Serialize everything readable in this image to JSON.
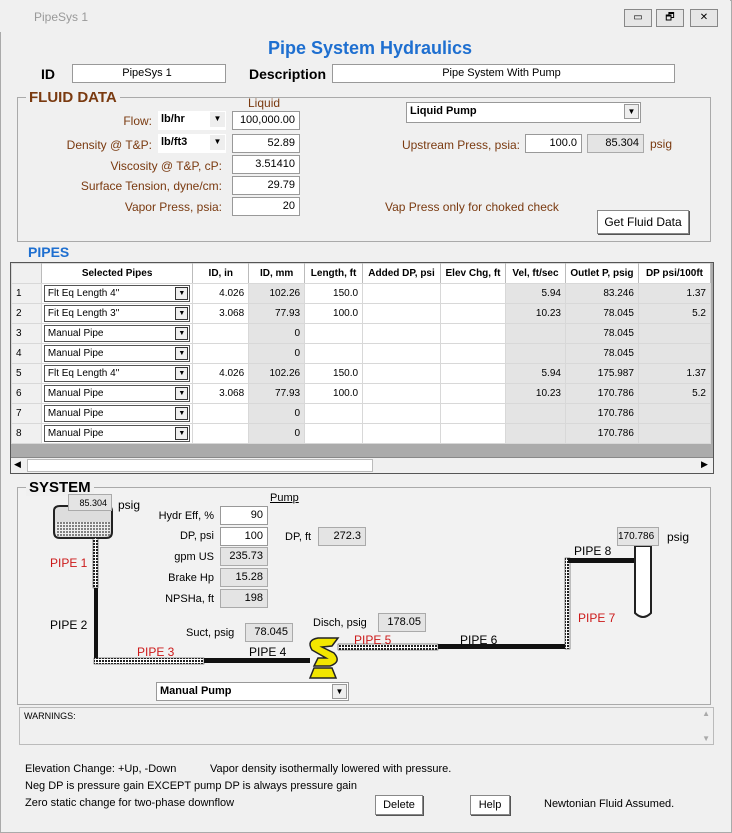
{
  "window": {
    "title": "PipeSys 1",
    "minimize": "▭",
    "restore": "🗗",
    "close": "✕"
  },
  "header": {
    "title": "Pipe System Hydraulics",
    "id_label": "ID",
    "id_value": "PipeSys 1",
    "desc_label": "Description",
    "desc_value": "Pipe System With Pump"
  },
  "fluid": {
    "title": "FLUID DATA",
    "phase": "Liquid",
    "flow_label": "Flow:",
    "flow_unit": "lb/hr",
    "flow": "100,000.00",
    "density_label": "Density @ T&P:",
    "density_unit": "lb/ft3",
    "density": "52.89",
    "visc_label": "Viscosity @ T&P, cP:",
    "visc": "3.51410",
    "st_label": "Surface Tension, dyne/cm:",
    "st": "29.79",
    "vp_label": "Vapor Press, psia:",
    "vp": "20",
    "type": "Liquid Pump",
    "up_label": "Upstream Press, psia:",
    "up_psia": "100.0",
    "up_psig": "85.304",
    "psig": "psig",
    "vp_note": "Vap Press only for choked check",
    "get_btn": "Get Fluid Data"
  },
  "pipes": {
    "title": "PIPES",
    "headers": [
      "Selected Pipes",
      "ID, in",
      "ID, mm",
      "Length, ft",
      "Added DP, psi",
      "Elev Chg, ft",
      "Vel, ft/sec",
      "Outlet P, psig",
      "DP psi/100ft"
    ],
    "rows": [
      {
        "n": "1",
        "pipe": "Flt Eq Length 4\"",
        "idin": "4.026",
        "idmm": "102.26",
        "len": "150.0",
        "adp": "",
        "elev": "",
        "vel": "5.94",
        "out": "83.246",
        "dp": "1.37"
      },
      {
        "n": "2",
        "pipe": "Fit Eq Length 3\"",
        "idin": "3.068",
        "idmm": "77.93",
        "len": "100.0",
        "adp": "",
        "elev": "",
        "vel": "10.23",
        "out": "78.045",
        "dp": "5.2"
      },
      {
        "n": "3",
        "pipe": "Manual Pipe",
        "idin": "",
        "idmm": "0",
        "len": "",
        "adp": "",
        "elev": "",
        "vel": "",
        "out": "78.045",
        "dp": ""
      },
      {
        "n": "4",
        "pipe": "Manual Pipe",
        "idin": "",
        "idmm": "0",
        "len": "",
        "adp": "",
        "elev": "",
        "vel": "",
        "out": "78.045",
        "dp": ""
      },
      {
        "n": "5",
        "pipe": "Flt Eq Length 4\"",
        "idin": "4.026",
        "idmm": "102.26",
        "len": "150.0",
        "adp": "",
        "elev": "",
        "vel": "5.94",
        "out": "175.987",
        "dp": "1.37"
      },
      {
        "n": "6",
        "pipe": "Manual Pipe",
        "idin": "3.068",
        "idmm": "77.93",
        "len": "100.0",
        "adp": "",
        "elev": "",
        "vel": "10.23",
        "out": "170.786",
        "dp": "5.2"
      },
      {
        "n": "7",
        "pipe": "Manual Pipe",
        "idin": "",
        "idmm": "0",
        "len": "",
        "adp": "",
        "elev": "",
        "vel": "",
        "out": "170.786",
        "dp": ""
      },
      {
        "n": "8",
        "pipe": "Manual Pipe",
        "idin": "",
        "idmm": "0",
        "len": "",
        "adp": "",
        "elev": "",
        "vel": "",
        "out": "170.786",
        "dp": ""
      }
    ]
  },
  "system": {
    "title": "SYSTEM",
    "src_psig": "85.304",
    "psig": "psig",
    "pump_title": "Pump",
    "eff_label": "Hydr Eff, %",
    "eff": "90",
    "dp_label": "DP, psi",
    "dp": "100",
    "dpft_label": "DP, ft",
    "dpft": "272.3",
    "gpm_label": "gpm US",
    "gpm": "235.73",
    "bhp_label": "Brake Hp",
    "bhp": "15.28",
    "npsh_label": "NPSHa, ft",
    "npsh": "198",
    "suct_label": "Suct, psig",
    "suct": "78.045",
    "disch_label": "Disch, psig",
    "disch": "178.05",
    "dest_psig": "170.786",
    "pump_type": "Manual Pump",
    "pipe_labels": [
      "PIPE 1",
      "PIPE 2",
      "PIPE 3",
      "PIPE 4",
      "PIPE 5",
      "PIPE 6",
      "PIPE 7",
      "PIPE 8"
    ]
  },
  "warnings": {
    "label": "WARNINGS:"
  },
  "footer": {
    "elev": "Elevation Change:  +Up, -Down",
    "vapor": "Vapor density isothermally lowered with pressure.",
    "neg": "Neg DP is pressure gain EXCEPT pump DP is always pressure gain",
    "zero": "Zero static change for two-phase downflow",
    "delete": "Delete",
    "help": "Help",
    "newtonian": "Newtonian Fluid Assumed."
  },
  "colors": {
    "title_blue": "#1e6fd0",
    "label_brown": "#7a3a10",
    "pipe_red": "#cc1a1a",
    "pump_yellow": "#f2e600"
  }
}
